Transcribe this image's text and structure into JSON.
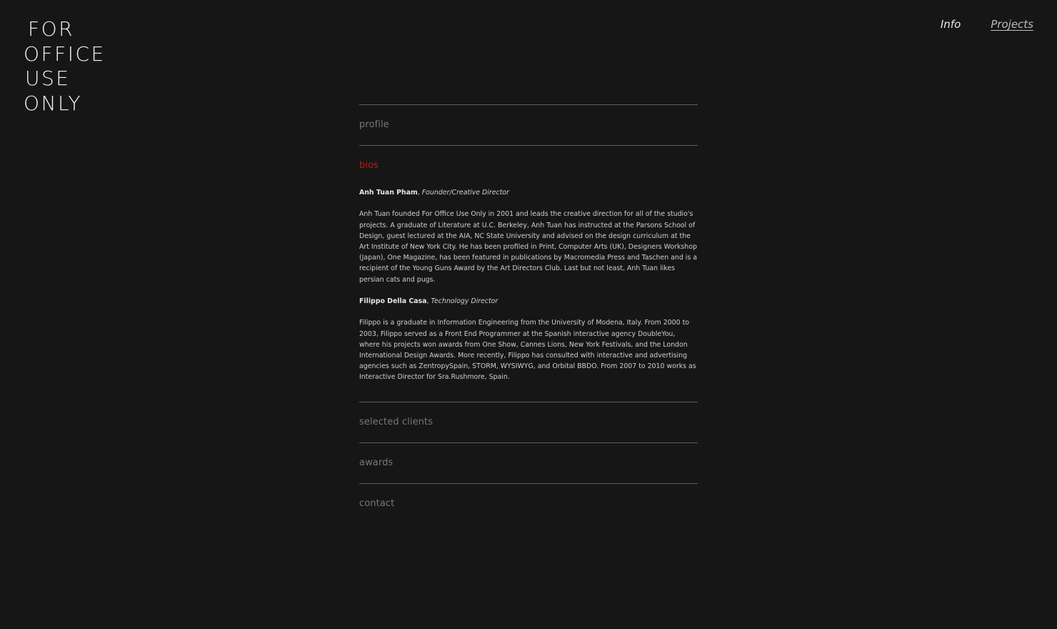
{
  "logo": {
    "line1": "FOR",
    "line2": "OFFICE",
    "line3": "USE",
    "line4": "ONLY"
  },
  "nav": {
    "info": "Info",
    "projects": "Projects"
  },
  "sections": {
    "profile": "profile",
    "bios": "bios",
    "selected_clients": "selected clients",
    "awards": "awards",
    "contact": "contact"
  },
  "bios": [
    {
      "name": "Anh Tuan Pham",
      "separator": ", ",
      "role": "Founder/Creative Director",
      "text": "Anh Tuan founded For Office Use Only in 2001 and leads the creative direction for all of the studio's projects. A graduate of Literature at U.C. Berkeley, Anh Tuan has instructed at the Parsons School of Design, guest lectured at the AIA, NC State University and advised on the design curriculum at the Art Institute of New York City. He has been profiled in Print, Computer Arts (UK), Designers Workshop (Japan), One Magazine, has been featured in publications by Macromedia Press and Taschen and is a recipient of the Young Guns Award by the Art Directors Club. Last but not least, Anh Tuan likes persian cats and pugs."
    },
    {
      "name": "Filippo Della Casa",
      "separator": ", ",
      "role": "Technology Director",
      "text": "Filippo is a graduate in Information Engineering from the University of Modena, Italy. From 2000 to 2003, Filippo served as a Front End Programmer at the Spanish interactive agency DoubleYou, where his projects won awards from One Show, Cannes Lions, New York Festivals, and the London International Design Awards. More recently, Filippo has consulted with interactive and advertising agencies such as ZentropySpain, STORM, WYSIWYG, and Orbital BBDO. From 2007 to 2010 works as Interactive Director for Sra.Rushmore, Spain."
    }
  ],
  "colors": {
    "background": "#161616",
    "accent": "#c21a14",
    "divider": "#5e5e5e"
  }
}
